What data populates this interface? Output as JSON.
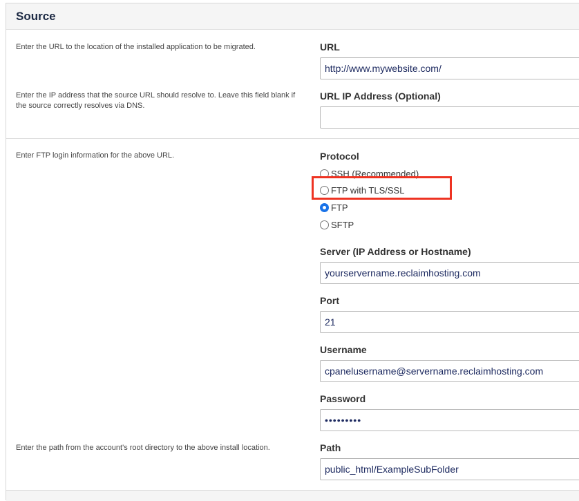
{
  "panel": {
    "title": "Source"
  },
  "help": {
    "url": "Enter the URL to the location of the installed application to be migrated.",
    "ip": "Enter the IP address that the source URL should resolve to. Leave this field blank if the source correctly resolves via DNS.",
    "ftp": "Enter FTP login information for the above URL.",
    "path": "Enter the path from the account's root directory to the above install location."
  },
  "fields": {
    "url": {
      "label": "URL",
      "value": "http://www.mywebsite.com/"
    },
    "ip": {
      "label": "URL IP Address (Optional)",
      "value": ""
    },
    "server": {
      "label": "Server (IP Address or Hostname)",
      "value": "yourservername.reclaimhosting.com"
    },
    "port": {
      "label": "Port",
      "value": "21"
    },
    "username": {
      "label": "Username",
      "value": "cpanelusername@servername.reclaimhosting.com"
    },
    "password": {
      "label": "Password",
      "value": "•••••••••"
    },
    "path": {
      "label": "Path",
      "value": "public_html/ExampleSubFolder"
    }
  },
  "protocol": {
    "label": "Protocol",
    "options": [
      {
        "label": "SSH (Recommended)",
        "checked": false
      },
      {
        "label": "FTP with TLS/SSL",
        "checked": false
      },
      {
        "label": "FTP",
        "checked": true
      },
      {
        "label": "SFTP",
        "checked": false
      }
    ]
  },
  "colors": {
    "highlight": "#ee3322",
    "radio_checked": "#1a73e8",
    "title": "#1d2a44"
  }
}
